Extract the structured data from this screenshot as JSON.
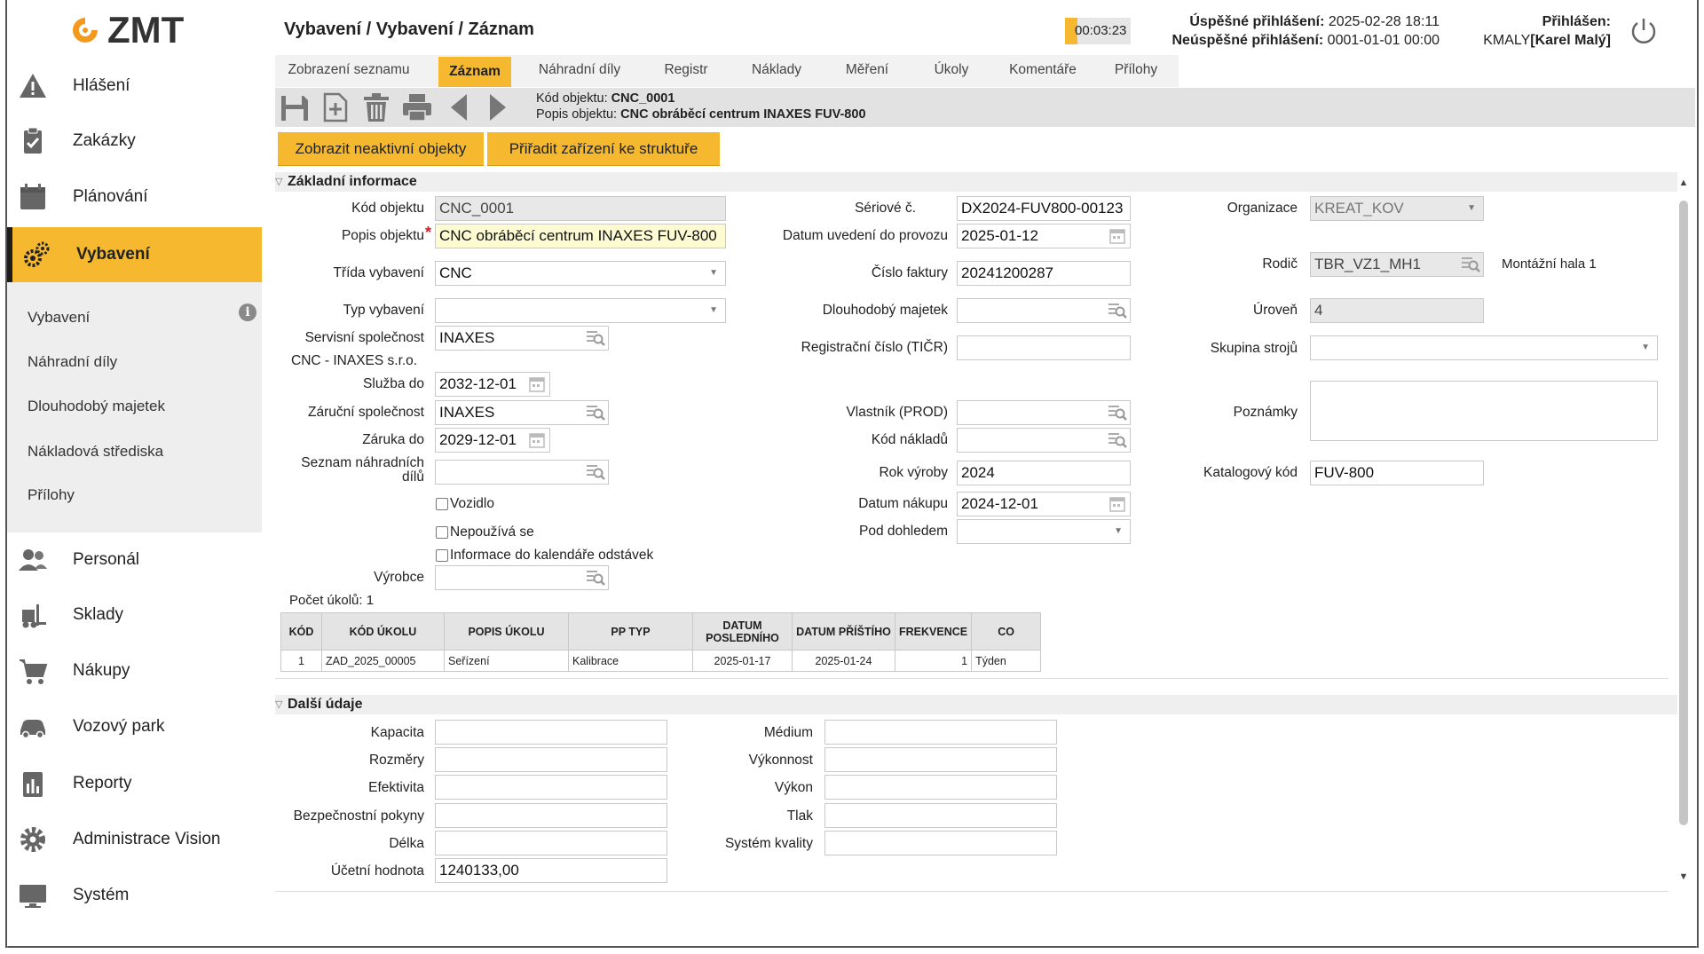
{
  "logo": {
    "text": "ZMT"
  },
  "header": {
    "title": "Vybavení / Vybavení / Záznam",
    "timer": "00:03:23",
    "login_success_label": "Úspěšné přihlášení:",
    "login_success_value": "2025-02-28 18:11",
    "login_fail_label": "Neúspěšné přihlášení:",
    "login_fail_value": "0001-01-01 00:00",
    "logged_in_label": "Přihlášen:",
    "logged_in_user_code": "KMALY",
    "logged_in_user_name": "[Karel Malý]"
  },
  "sidebar": {
    "items": [
      {
        "label": "Hlášení",
        "icon": "warning-icon"
      },
      {
        "label": "Zakázky",
        "icon": "clipboard-icon"
      },
      {
        "label": "Plánování",
        "icon": "calendar-icon"
      },
      {
        "label": "Vybavení",
        "icon": "gears-icon",
        "active": true
      },
      {
        "label": "Personál",
        "icon": "people-icon"
      },
      {
        "label": "Sklady",
        "icon": "forklift-icon"
      },
      {
        "label": "Nákupy",
        "icon": "cart-icon"
      },
      {
        "label": "Vozový park",
        "icon": "car-icon"
      },
      {
        "label": "Reporty",
        "icon": "report-icon"
      },
      {
        "label": "Administrace Vision",
        "icon": "gear-icon"
      },
      {
        "label": "Systém",
        "icon": "monitor-icon"
      }
    ],
    "subitems": [
      "Vybavení",
      "Náhradní díly",
      "Dlouhodobý majetek",
      "Nákladová střediska",
      "Přílohy"
    ],
    "info_glyph": "i"
  },
  "tabs": [
    {
      "label": "Zobrazení seznamu"
    },
    {
      "label": "Záznam",
      "active": true
    },
    {
      "label": "Náhradní díly"
    },
    {
      "label": "Registr"
    },
    {
      "label": "Náklady"
    },
    {
      "label": "Měření"
    },
    {
      "label": "Úkoly"
    },
    {
      "label": "Komentáře"
    },
    {
      "label": "Přílohy"
    }
  ],
  "toolbar": {
    "icons": [
      "save-icon",
      "add-icon",
      "delete-icon",
      "print-icon",
      "previous-icon",
      "next-icon"
    ],
    "object_code_label": "Kód objektu:",
    "object_code_value": "CNC_0001",
    "object_desc_label": "Popis objektu:",
    "object_desc_value": "CNC obráběcí centrum INAXES FUV-800"
  },
  "actions": {
    "show_inactive": "Zobrazit neaktivní objekty",
    "assign_structure": "Přiřadit zařízení ke struktuře"
  },
  "basic": {
    "section_title": "Základní informace",
    "kod_objektu": {
      "label": "Kód objektu",
      "value": "CNC_0001"
    },
    "popis_objektu": {
      "label": "Popis objektu",
      "value": "CNC obráběcí centrum INAXES FUV-800"
    },
    "trida_vybaveni": {
      "label": "Třída vybavení",
      "value": "CNC"
    },
    "typ_vybaveni": {
      "label": "Typ vybavení",
      "value": ""
    },
    "servisni_spolecnost": {
      "label": "Servisní společnost",
      "value": "INAXES",
      "desc": "CNC - INAXES s.r.o."
    },
    "sluzba_do": {
      "label": "Služba do",
      "value": "2032-12-01"
    },
    "zarucni_spolecnost": {
      "label": "Záruční společnost",
      "value": "INAXES"
    },
    "zaruka_do": {
      "label": "Záruka do",
      "value": "2029-12-01"
    },
    "seznam_nd": {
      "label": "Seznam náhradních dílů",
      "value": ""
    },
    "vozidlo": {
      "label": "Vozidlo"
    },
    "nepouziva_se": {
      "label": "Nepoužívá se"
    },
    "info_kalendar": {
      "label": "Informace do kalendáře odstávek"
    },
    "vyrobce": {
      "label": "Výrobce",
      "value": ""
    },
    "seriove_c": {
      "label": "Sériové č.",
      "value": "DX2024-FUV800-00123"
    },
    "datum_uvedeni": {
      "label": "Datum uvedení do provozu",
      "value": "2025-01-12"
    },
    "cislo_faktury": {
      "label": "Číslo faktury",
      "value": "20241200287"
    },
    "dlouhodoby_majetek": {
      "label": "Dlouhodobý majetek",
      "value": ""
    },
    "registracni_cislo": {
      "label": "Registrační číslo (TIČR)",
      "value": ""
    },
    "vlastnik": {
      "label": "Vlastník (PROD)",
      "value": ""
    },
    "kod_nakladu": {
      "label": "Kód nákladů",
      "value": ""
    },
    "rok_vyroby": {
      "label": "Rok výroby",
      "value": "2024"
    },
    "datum_nakupu": {
      "label": "Datum nákupu",
      "value": "2024-12-01"
    },
    "pod_dohledem": {
      "label": "Pod dohledem",
      "value": ""
    },
    "organizace": {
      "label": "Organizace",
      "value": "KREAT_KOV"
    },
    "rodic": {
      "label": "Rodič",
      "value": "TBR_VZ1_MH1",
      "desc": "Montážní hala 1"
    },
    "uroven": {
      "label": "Úroveň",
      "value": "4"
    },
    "skupina_stroju": {
      "label": "Skupina strojů",
      "value": ""
    },
    "poznamky": {
      "label": "Poznámky",
      "value": ""
    },
    "katalogovy_kod": {
      "label": "Katalogový kód",
      "value": "FUV-800"
    }
  },
  "tasks": {
    "count_label": "Počet úkolů:",
    "count_value": "1",
    "columns": [
      "KÓD",
      "KÓD ÚKOLU",
      "POPIS ÚKOLU",
      "PP TYP",
      "DATUM POSLEDNÍHO",
      "DATUM PŘÍŠTÍHO",
      "FREKVENCE",
      "CO"
    ],
    "rows": [
      [
        "1",
        "ZAD_2025_00005",
        "Seřízení",
        "Kalibrace",
        "2025-01-17",
        "2025-01-24",
        "1",
        "Týden"
      ]
    ]
  },
  "extra": {
    "section_title": "Další údaje",
    "kapacita": {
      "label": "Kapacita",
      "value": ""
    },
    "rozmery": {
      "label": "Rozměry",
      "value": ""
    },
    "efektivita": {
      "label": "Efektivita",
      "value": ""
    },
    "bezpecnostni_pokyny": {
      "label": "Bezpečnostní pokyny",
      "value": ""
    },
    "delka": {
      "label": "Délka",
      "value": ""
    },
    "ucetni_hodnota": {
      "label": "Účetní hodnota",
      "value": "1240133,00"
    },
    "medium": {
      "label": "Médium",
      "value": ""
    },
    "vykonnost": {
      "label": "Výkonnost",
      "value": ""
    },
    "vykon": {
      "label": "Výkon",
      "value": ""
    },
    "tlak": {
      "label": "Tlak",
      "value": ""
    },
    "system_kvality": {
      "label": "Systém kvality",
      "value": ""
    }
  },
  "colors": {
    "accent": "#f5b82e",
    "logo_orange": "#f39a1e",
    "required": "#d41c1c"
  }
}
